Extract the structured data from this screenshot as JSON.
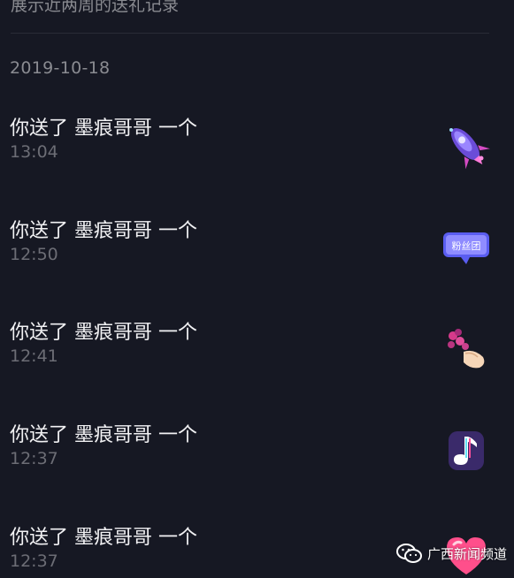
{
  "header": {
    "note": "展示近两周的送礼记录"
  },
  "date_label": "2019-10-18",
  "gifts": [
    {
      "title": "你送了 墨痕哥哥 一个",
      "time": "13:04",
      "icon": "rocket-icon"
    },
    {
      "title": "你送了 墨痕哥哥 一个",
      "time": "12:50",
      "icon": "fan-club-badge-icon",
      "icon_text": "粉丝团"
    },
    {
      "title": "你送了 墨痕哥哥 一个",
      "time": "12:41",
      "icon": "hand-flowers-icon"
    },
    {
      "title": "你送了 墨痕哥哥 一个",
      "time": "12:37",
      "icon": "music-note-icon"
    },
    {
      "title": "你送了 墨痕哥哥 一个",
      "time": "12:37",
      "icon": "heart-icon"
    }
  ],
  "watermark": {
    "text": "广西新闻频道",
    "icon": "wechat-icon"
  },
  "colors": {
    "background": "#161823",
    "primary_text": "#f2f2f4",
    "secondary_text": "#8a8b91",
    "time_text": "#6c6d75",
    "divider": "#2a2c36"
  }
}
